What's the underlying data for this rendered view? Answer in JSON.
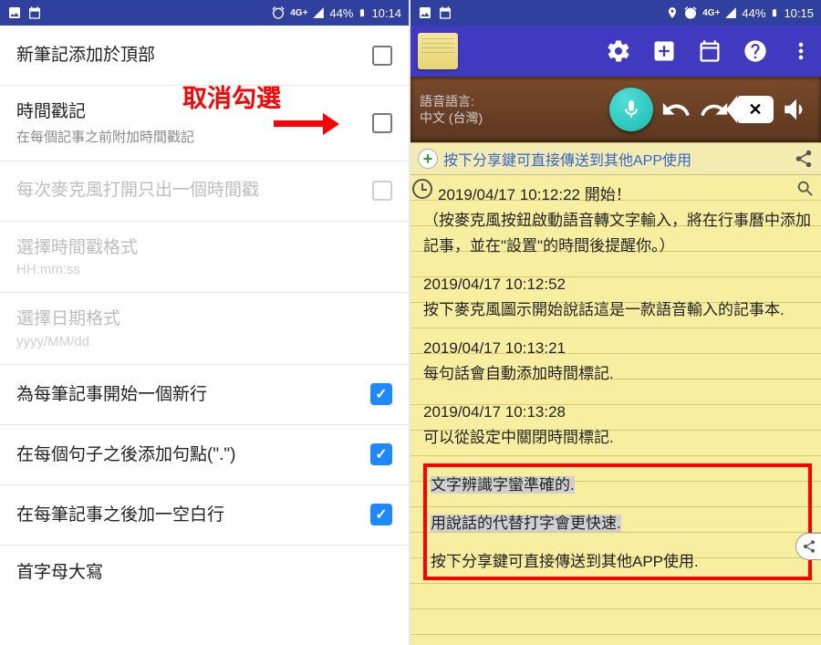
{
  "statusbar": {
    "battery": "44%",
    "time_left": "10:14",
    "time_right": "10:15",
    "network_label": "4G+"
  },
  "annotation": {
    "cancel_check": "取消勾選"
  },
  "settings": {
    "new_note_top": "新筆記添加於頂部",
    "timestamp_title": "時間戳記",
    "timestamp_sub": "在每個記事之前附加時間戳記",
    "single_ts": "每次麥克風打開只出一個時間戳",
    "ts_format_title": "選擇時間戳格式",
    "ts_format_sub": "HH:mm:ss",
    "date_format_title": "選擇日期格式",
    "date_format_sub": "yyyy/MM/dd",
    "newline_per_note": "為每筆記事開始一個新行",
    "period_per_sentence": "在每個句子之後添加句點(\".\")",
    "blank_after_note": "在每筆記事之後加一空白行",
    "capitalize": "首字母大寫"
  },
  "wood": {
    "lang_label": "語音語言:",
    "lang_value": "中文 (台灣)"
  },
  "sharebar": {
    "text": "按下分享鍵可直接傳送到其他APP使用"
  },
  "notes": {
    "b1_ts": "2019/04/17 10:12:22 開始！",
    "b1_body": "（按麥克風按鈕啟動語音轉文字輸入，將在行事曆中添加記事，並在\"設置\"的時間後提醒你。）",
    "b2_ts": "2019/04/17 10:12:52",
    "b2_body": "按下麥克風圖示開始說話這是一款語音輸入的記事本.",
    "b3_ts": "2019/04/17 10:13:21",
    "b3_body": "每句話會自動添加時間標記.",
    "b4_ts": "2019/04/17 10:13:28",
    "b4_body": "可以從設定中關閉時間標記.",
    "h1": "文字辨識字蠻準確的.",
    "h2": "用說話的代替打字會更快速.",
    "h3": "按下分享鍵可直接傳送到其他APP使用."
  }
}
